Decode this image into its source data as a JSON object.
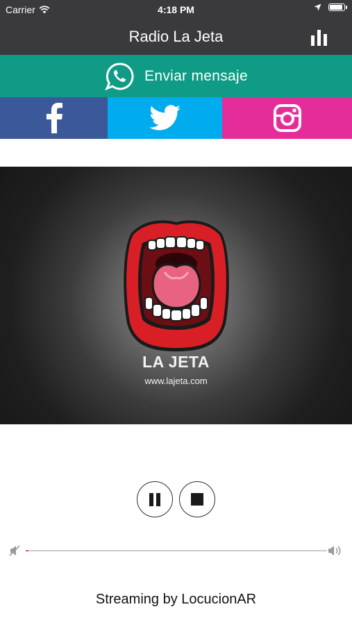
{
  "status_bar": {
    "carrier": "Carrier",
    "time": "4:18 PM",
    "battery_level": 0.95,
    "icons": [
      "wifi-icon",
      "location-arrow-icon",
      "battery-icon"
    ]
  },
  "nav": {
    "title": "Radio La Jeta",
    "right_icon": "equalizer-icon"
  },
  "whatsapp": {
    "label": "Enviar mensaje",
    "icon": "whatsapp-icon",
    "color": "#0f9b85"
  },
  "social": [
    {
      "name": "facebook",
      "icon": "facebook-icon",
      "color": "#3b5998"
    },
    {
      "name": "twitter",
      "icon": "twitter-icon",
      "color": "#00aced"
    },
    {
      "name": "instagram",
      "icon": "instagram-icon",
      "color": "#e52d9a"
    }
  ],
  "logo": {
    "title": "LA JETA",
    "url": "www.lajeta.com"
  },
  "player": {
    "pause_icon": "pause-icon",
    "stop_icon": "stop-icon"
  },
  "volume": {
    "level": 0.01,
    "min_icon": "speaker-mute-icon",
    "max_icon": "speaker-loud-icon"
  },
  "footer": {
    "text": "Streaming by LocucionAR"
  }
}
